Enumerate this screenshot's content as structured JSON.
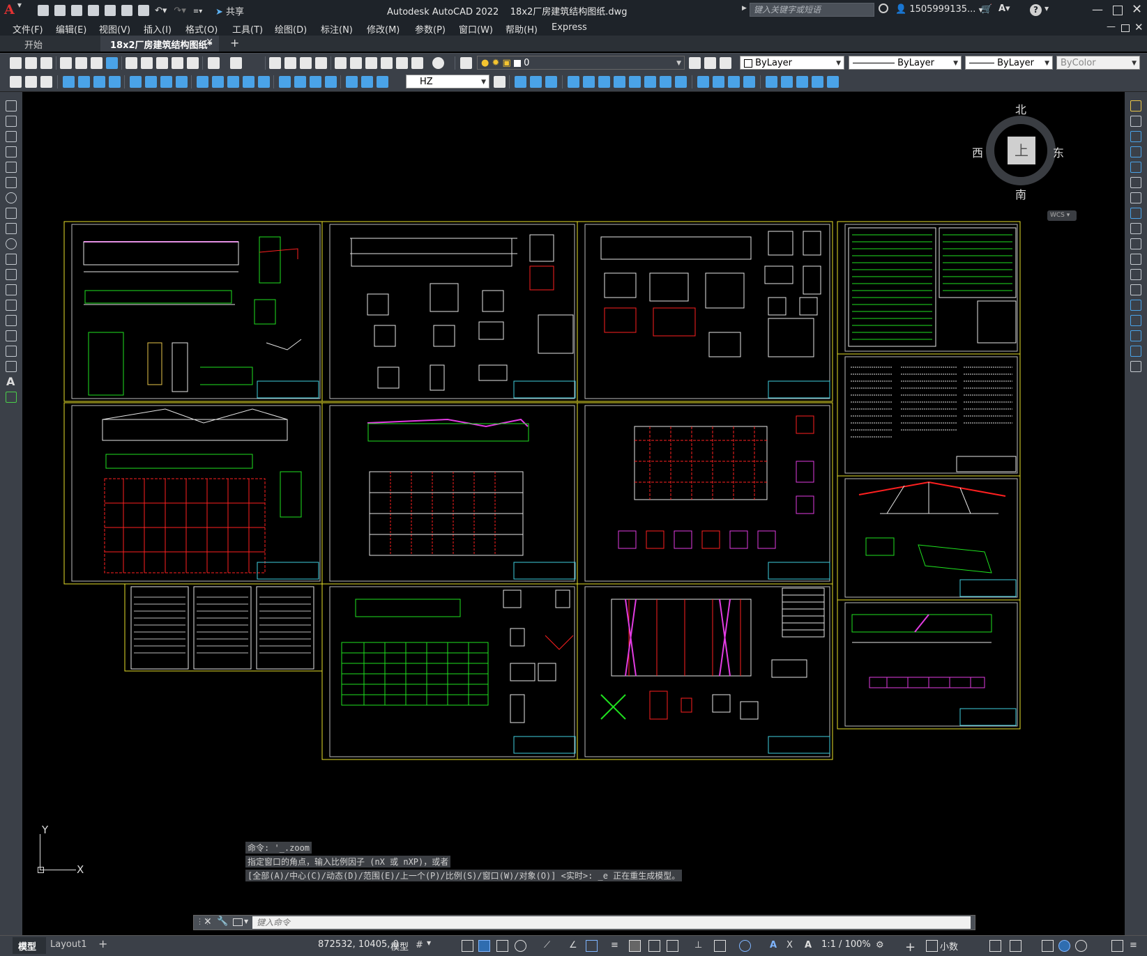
{
  "titlebar": {
    "app_logo": "A",
    "share_label": "共享",
    "title": "Autodesk AutoCAD 2022    18x2厂房建筑结构图纸.dwg",
    "search_placeholder": "键入关键字或短语",
    "username": "1505999135...",
    "help_label": "?"
  },
  "menu": [
    "文件(F)",
    "编辑(E)",
    "视图(V)",
    "插入(I)",
    "格式(O)",
    "工具(T)",
    "绘图(D)",
    "标注(N)",
    "修改(M)",
    "参数(P)",
    "窗口(W)",
    "帮助(H)",
    "Express"
  ],
  "tabs": {
    "start": "开始",
    "active": "18x2厂房建筑结构图纸*",
    "add": "+"
  },
  "toolbar": {
    "layer_value": "0",
    "color_value": "ByLayer",
    "linetype_value": "ByLayer",
    "lineweight_value": "ByLayer",
    "plotstyle_value": "ByColor",
    "textstyle_value": "HZ"
  },
  "viewcube": {
    "north": "北",
    "south": "南",
    "east": "东",
    "west": "西",
    "top": "上",
    "wcs": "WCS"
  },
  "ucs": {
    "x": "X",
    "y": "Y"
  },
  "command": {
    "history": [
      "命令: '_.zoom",
      "指定窗口的角点，输入比例因子 (nX 或 nXP)，或者",
      "[全部(A)/中心(C)/动态(D)/范围(E)/上一个(P)/比例(S)/窗口(W)/对象(O)] <实时>: _e 正在重生成模型。"
    ],
    "input_placeholder": "键入命令"
  },
  "status": {
    "model_tab": "模型",
    "layout_tab": "Layout1",
    "coords": "872532, 10405, 0",
    "model_label": "模型",
    "scale": "1:1 / 100%",
    "units": "小数"
  },
  "colors": {
    "sheet_border": "#e8e02a",
    "line_white": "#e6e6e6",
    "line_green": "#1fe21f",
    "line_magenta": "#e23ce2",
    "line_red": "#ff2020",
    "line_cyan": "#3fd0e0"
  }
}
